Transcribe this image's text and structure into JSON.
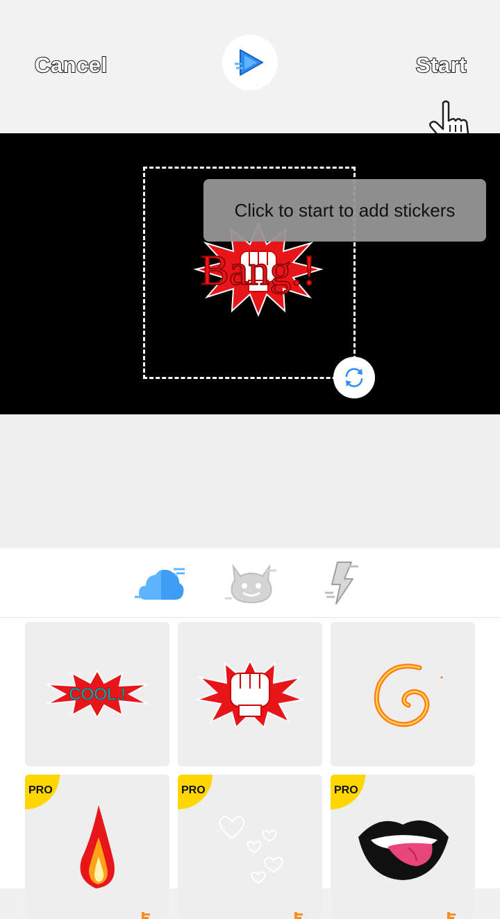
{
  "header": {
    "cancel_label": "Cancel",
    "start_label": "Start",
    "logo_icon": "play-logo-icon",
    "pointer_icon": "hand-pointer-icon"
  },
  "preview": {
    "sticker_text": "Bang.!",
    "tooltip": "Click to start to add stickers",
    "rotate_icon": "rotate-icon"
  },
  "tabs": [
    {
      "icon": "cloud-icon",
      "selected": true
    },
    {
      "icon": "devil-face-icon",
      "selected": false
    },
    {
      "icon": "lightning-icon",
      "selected": false
    }
  ],
  "stickers": [
    {
      "name": "cool-sticker",
      "text": "COOL.!",
      "pro": false
    },
    {
      "name": "fist-sticker",
      "pro": false
    },
    {
      "name": "fire-swirl-sticker",
      "pro": false
    },
    {
      "name": "flame-sticker",
      "pro": true
    },
    {
      "name": "hearts-sticker",
      "pro": true
    },
    {
      "name": "lips-sticker",
      "pro": true
    }
  ],
  "pro_label": "PRO",
  "colors": {
    "accent_blue": "#2f8df0",
    "pro_yellow": "#ffd600",
    "burst_red": "#e8161a"
  }
}
